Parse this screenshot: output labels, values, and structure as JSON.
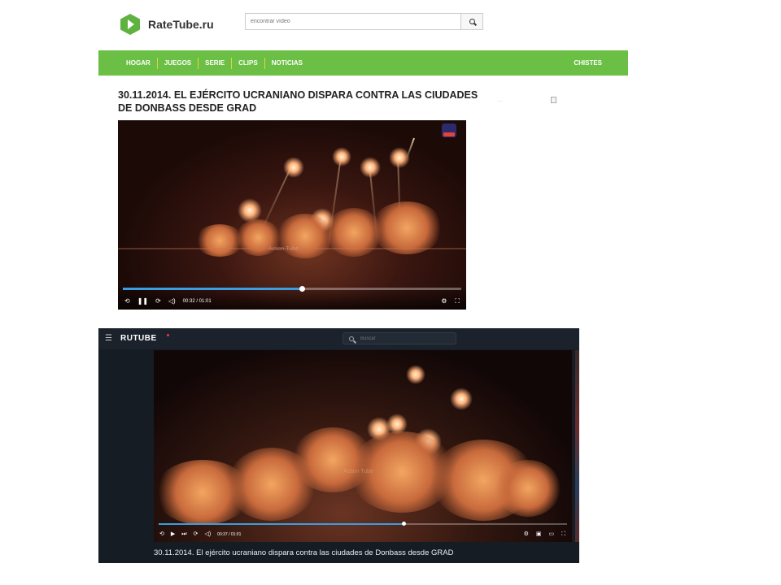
{
  "site": {
    "name": "RateTube.ru",
    "search_placeholder": "encontrar vídeo"
  },
  "nav": {
    "items": [
      "HOGAR",
      "JUEGOS",
      "SERIE",
      "CLIPS",
      "NOTICIAS"
    ],
    "right": "CHISTES"
  },
  "page_title": "30.11.2014. EL EJÉRCITO UCRANIANO DISPARA CONTRA LAS CIUDADES DE DONBASS DESDE GRAD",
  "player1": {
    "time": "00:32 / 01:01",
    "progress_fraction": 0.53,
    "watermark": "Action Tube"
  },
  "rutube": {
    "logo": "RUTUBE",
    "search_placeholder": "Buscar",
    "time": "00:37 / 01:01",
    "progress_fraction": 0.6,
    "watermark": "Action Tube",
    "caption": "30.11.2014. El ejército ucraniano dispara contra las ciudades de Donbass desde GRAD"
  },
  "colors": {
    "nav_green": "#6cbf45",
    "logo_green": "#5fb240",
    "progress_blue": "#3a9ee0",
    "rutube_bg": "#151c24"
  }
}
